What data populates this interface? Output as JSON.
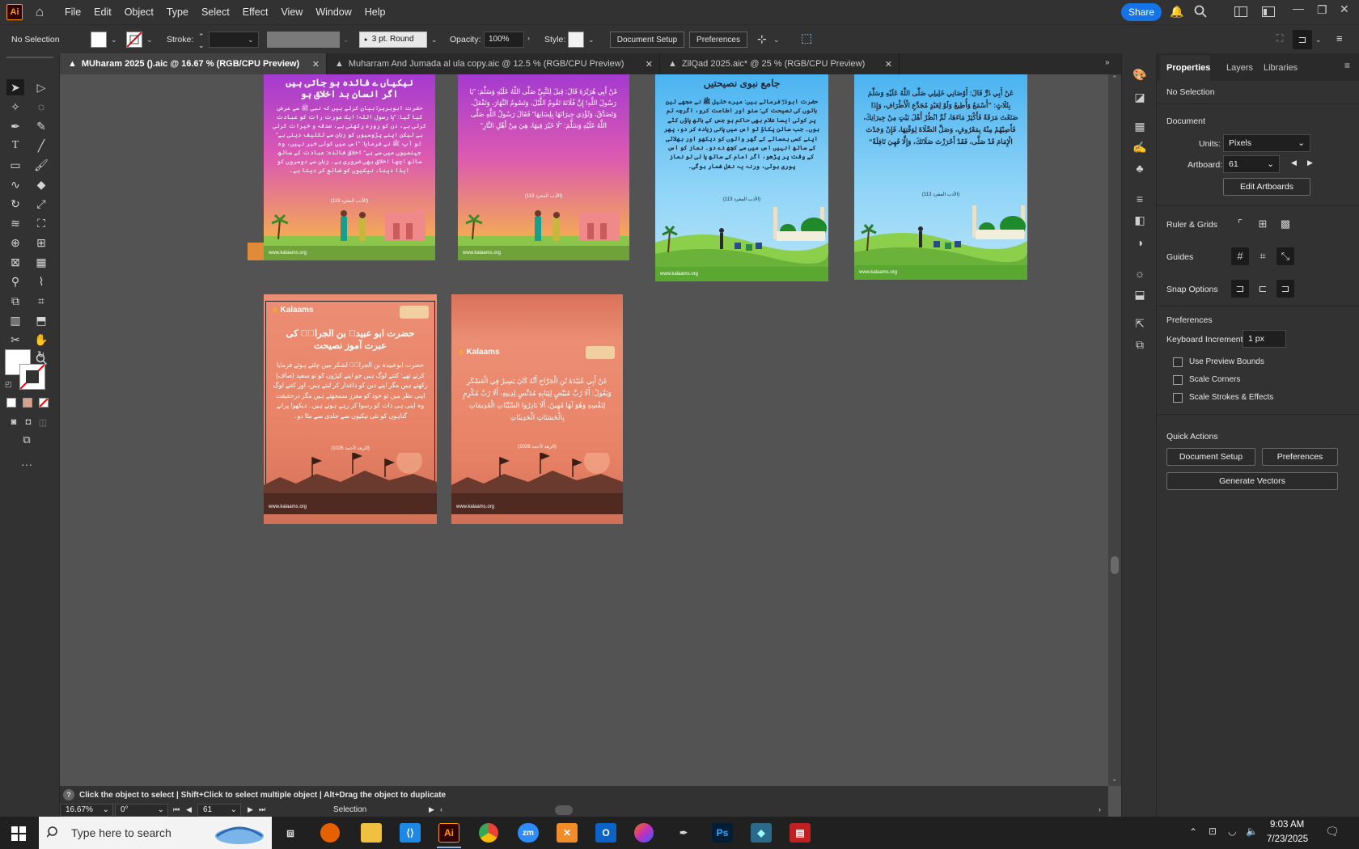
{
  "app": {
    "logo": "Ai",
    "menu": [
      "File",
      "Edit",
      "Object",
      "Type",
      "Select",
      "Effect",
      "View",
      "Window",
      "Help"
    ],
    "share_label": "Share"
  },
  "control": {
    "selection": "No Selection",
    "stroke_label": "Stroke:",
    "brush": "3 pt. Round",
    "opacity_label": "Opacity:",
    "opacity_value": "100%",
    "style_label": "Style:",
    "doc_setup": "Document Setup",
    "preferences": "Preferences"
  },
  "tabs": [
    {
      "label": "MUharam 2025 ().aic @ 16.67 % (RGB/CPU Preview)"
    },
    {
      "label": "Muharram And Jumada al ula copy.aic @ 12.5 % (RGB/CPU Preview)"
    },
    {
      "label": "ZilQad 2025.aic* @ 25 % (RGB/CPU Preview)"
    }
  ],
  "artboards": {
    "a1": {
      "title": "نیکیاں ے فائدہ ہو جاتی ہیں اگر انسان بد اخلاق ہو",
      "body": "حضرت ابوہریرہؓ بیان کرتے ہیں کہ نبی ﷺ سے عرض کیا گیا: ”یا رسول اللہ! ایک عورت رات کو عبادت کرتی ہے، دن کو روزہ رکھتی ہے، صدقہ و خیرات کرتی ہے لیکن اپنے پڑوسیوں کو زبان سے تکلیف دیتی ہے“ تو آپ ﷺ نے فرمایا: ”اس میں کوئی خیر نہیں، وہ جہنمیوں میں سے ہے“ اخلاقی فائدہ: عبادت کے ساتھ ساتھ اچھا اخلاق بھی ضروری ہے۔ زبان سے دوسروں کو ایذا دینا، نیکیوں کو ضائع کر دیتا ہے۔",
      "ref": "(الأدب المفرد 119)",
      "site": "www.kalaams.org"
    },
    "a2": {
      "body": "عَنْ أَبِي هُرَيْرَةَ قَالَ: قِيلَ لِلنَّبِيِّ صَلَّى اللَّهُ عَلَيْهِ وَسَلَّمَ: ”يَا رَسُولَ اللَّهِ! إِنَّ فُلَانَةَ تَقُومُ اللَّيْلَ، وَتَصُومُ النَّهَارَ، وَتَفْعَلُ، وَتَصَدَّقُ، وَتُؤْذِي جِيرَانَهَا بِلِسَانِهَا“ فَقَالَ رَسُولُ اللَّهِ صَلَّى اللَّهُ عَلَيْهِ وَسَلَّمَ: ”لَا خَيْرَ فِيهَا، هِيَ مِنْ أَهْلِ النَّارِ“",
      "ref": "(الأدب المفرد 119)",
      "site": "www.kalaams.org"
    },
    "a3": {
      "title": "جامع نبوی نصیحتیں",
      "body": "حضرت ابوذرؓ فرماتے ہیں: میرے خلیل ﷺ نے مجھے تین باتوں کی نصیحت کی: سنو اور اطاعت کرو، اگرچہ تم پر کوئی ایسا غلام بھی حاکم ہو جس کے ہاتھ پاؤں کٹے ہوں۔ جب سالن پکاؤ تو اس میں پانی زیادہ کر دو، پھر اپنے کسی ہمسائے کے گھر والوں کو دیکھو اور بھلائی کے ساتھ انہیں اس میں سے کچھ دے دو۔ نماز کو اس کے وقت پر پڑھو، اگر امام کے ساتھ پا لی تو نماز پوری ہوئی، ورنہ یہ نفل شمار ہوگی۔",
      "ref": "(الأدب المفرد 113)",
      "site": "www.kalaams.org"
    },
    "a4": {
      "body": "عَنْ أَبِي ذَرٍّ قَالَ: أَوْصَانِي خَلِيلِي صَلَّى اللَّهُ عَلَيْهِ وَسَلَّمَ بِثَلَاثٍ: ”أَسْمَعُ وَأُطِيعُ وَلَوْ لِعَبْدٍ مُجَدَّعِ الْأَطْرَافِ، وَإِذَا صَنَعْتَ مَرَقَةً فَأَكْثِرْ مَاءَهَا، ثُمَّ انْظُرْ أَهْلَ بَيْتٍ مِنْ جِيرَانِكَ، فَأَصِبْهُمْ مِنْهُ بِمَعْرُوفٍ، وَصَلِّ الصَّلَاةَ لِوَقْتِهَا، فَإِنْ وَجَدْتَ الْإِمَامَ قَدْ صَلَّى، فَقَدْ أَحْرَزْتَ صَلَاتَكَ، وَإِلَّا فَهِيَ نَافِلَةٌ“",
      "ref": "(الأدب المفرد 113)",
      "site": "www.kalaams.org"
    },
    "a5": {
      "brand": "Kalaams",
      "title": "حضرت ابو عبیدہ بن الجراحؓ کی عبرت آموز نصیحت",
      "body": "حضرت ابوعبیدہ بن الجراحؓ لشکر میں چلتے ہوئے فرمایا کرتے تھے: کتنے لوگ ہیں جو اپنے کپڑوں کو تو سفید (صاف) رکھتے ہیں مگر اپنے دین کو داغدار کر لیتے ہیں، اور کتنے لوگ اپنی نظر میں تو خود کو معزز سمجھتے ہیں مگر درحقیقت وہ اپنی ہی ذات کو رسوا کر رہے ہوتے ہیں۔ دیکھو! پرانے گناہوں کو نئی نیکیوں سے جلدی سے مٹا دو۔",
      "ref": "(الزهد لأحمد 1026)",
      "site": "www.kalaams.org"
    },
    "a6": {
      "brand": "Kalaams",
      "body": "عَنْ أَبِي عُبَيْدَةَ بْنِ الْجَرَّاحِ أَنَّهُ كَانَ يَسِيرُ فِي الْعَسْكَرِ وَيَقُولُ: أَلَا رُبَّ مُبَيِّضٍ لِثِيَابِهِ مُدَنِّسٍ لِدِينِهِ، أَلَا رُبَّ مُكْرِمٍ لِنَفْسِهِ وَهُوَ لَهَا مُهِينٌ، أَلَا بَادِرُوا السَّيِّئَاتِ الْقَدِيمَاتِ بِالْحَسَنَاتِ الْحَدِيثَاتِ",
      "ref": "(الزهد لأحمد 1026)",
      "site": "www.kalaams.org"
    }
  },
  "panel": {
    "tabs": [
      "Properties",
      "Layers",
      "Libraries"
    ],
    "selection": "No Selection",
    "document_heading": "Document",
    "units_label": "Units:",
    "units_value": "Pixels",
    "artboard_label": "Artboard:",
    "artboard_value": "61",
    "edit_artboards": "Edit Artboards",
    "ruler_grids": "Ruler & Grids",
    "guides": "Guides",
    "snap_options": "Snap Options",
    "preferences_heading": "Preferences",
    "keyboard_increment_label": "Keyboard Increment:",
    "keyboard_increment_value": "1 px",
    "use_preview_bounds": "Use Preview Bounds",
    "scale_corners": "Scale Corners",
    "scale_strokes": "Scale Strokes & Effects",
    "quick_actions": "Quick Actions",
    "doc_setup": "Document Setup",
    "preferences": "Preferences",
    "generate_vectors": "Generate Vectors"
  },
  "status": {
    "hint": "Click the object to select  |  Shift+Click to select multiple object  |  Alt+Drag the object to duplicate",
    "zoom": "16.67%",
    "rotation": "0°",
    "artboard_num": "61",
    "tool_name": "Selection"
  },
  "taskbar": {
    "search_placeholder": "Type here to search",
    "time": "9:03 AM",
    "date": "7/23/2025"
  }
}
